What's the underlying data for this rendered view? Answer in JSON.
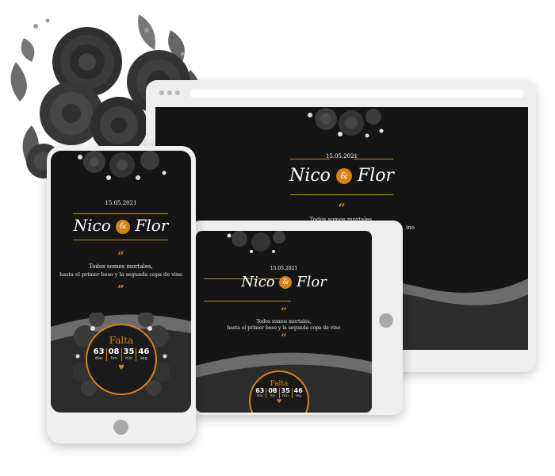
{
  "invitation": {
    "date": "15.05.2021",
    "name_left": "Nico",
    "ampersand": "&",
    "name_right": "Flor",
    "quote_open": "“",
    "quote_close": "”",
    "line1": "Todos somos mortales,",
    "line2": "hasta el primer beso y la segunda copa de vino",
    "countdown": {
      "title": "Falta",
      "days": "63",
      "days_label": "días",
      "hours": "08",
      "hours_label": "hrs",
      "minutes": "35",
      "minutes_label": "min",
      "seconds": "46",
      "seconds_label": "seg",
      "heart": "♥"
    }
  },
  "desktop_visible": {
    "line2_tail": "ino"
  },
  "colors": {
    "accent": "#d6821a",
    "screen_bg": "#151515",
    "device_frame": "#eeeeee",
    "wave_light": "#6c6c6c",
    "wave_dark": "#2c2c2c"
  }
}
